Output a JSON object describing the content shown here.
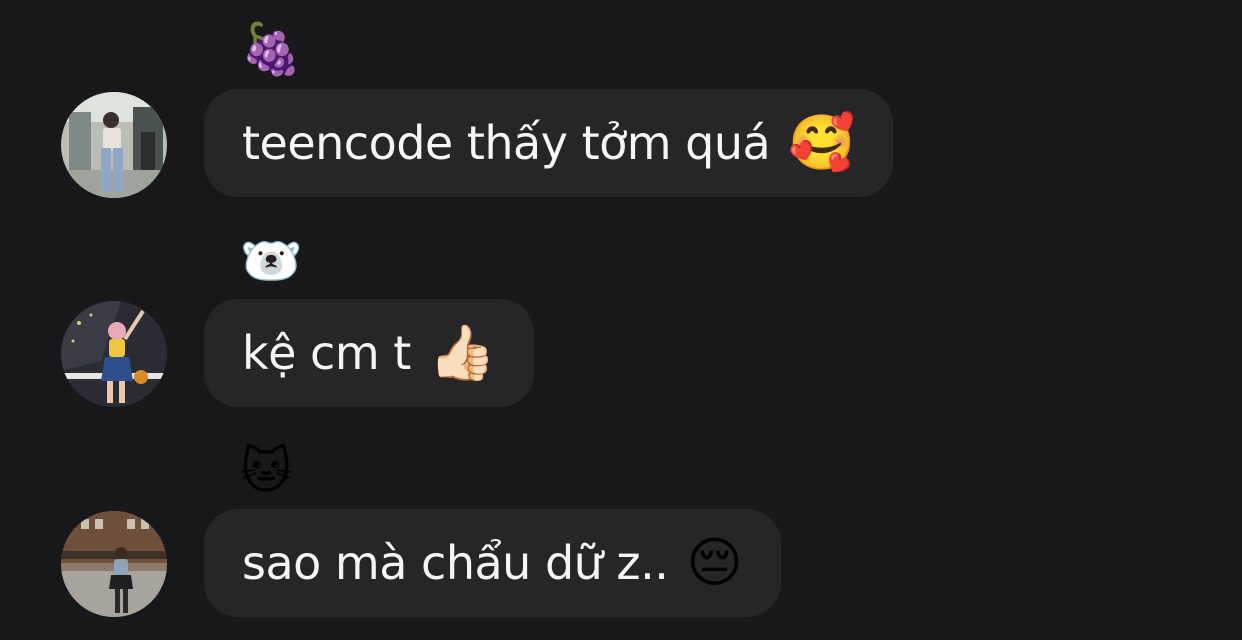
{
  "messages": [
    {
      "sender_emoji": "🍇",
      "text": "teencode thấy tởm quá",
      "emoji": "🥰"
    },
    {
      "sender_emoji": "🐻‍❄️",
      "text": "kệ cm t",
      "emoji": "👍🏻"
    },
    {
      "sender_emoji": "🐱",
      "text": "sao mà chẩu dữ z..",
      "emoji": "😔"
    }
  ],
  "colors": {
    "background": "#18181b",
    "bubble": "#262629",
    "text": "#f5f5f7"
  }
}
